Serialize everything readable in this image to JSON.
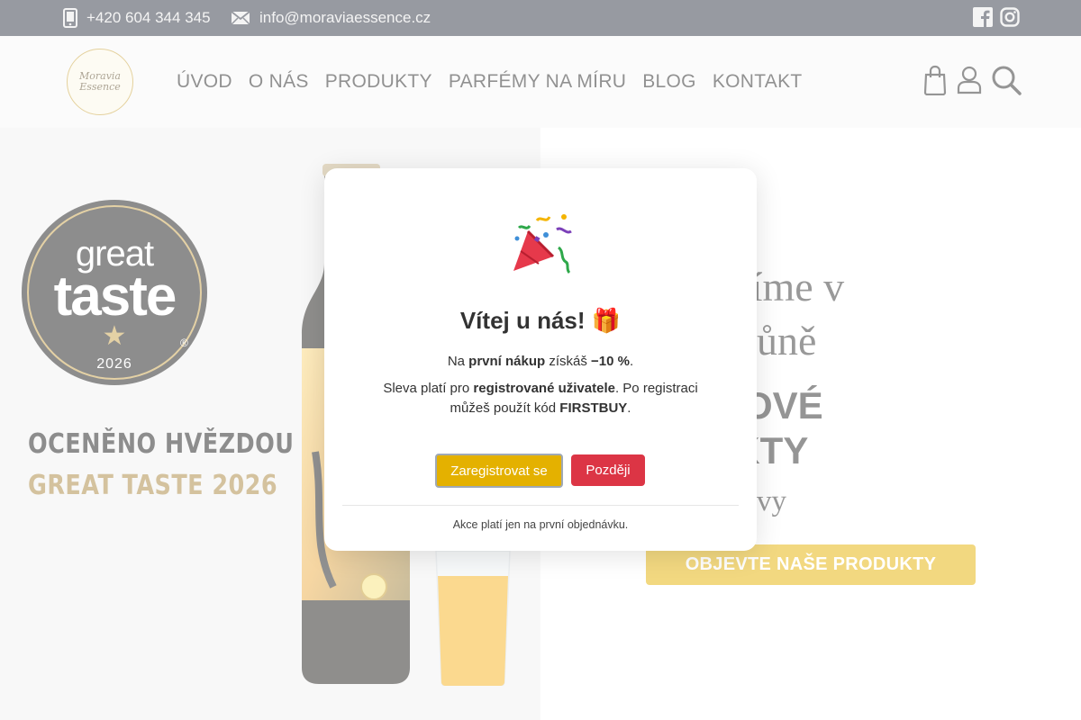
{
  "topbar": {
    "phone": "+420 604 344 345",
    "email": "info@moraviaessence.cz",
    "social": [
      "facebook-icon",
      "instagram-icon"
    ]
  },
  "header": {
    "logo_line1": "Moravia",
    "logo_line2": "Essence",
    "nav": [
      "ÚVOD",
      "O NÁS",
      "PRODUKTY",
      "PARFÉMY NA MÍRU",
      "BLOG",
      "KONTAKT"
    ],
    "icons": [
      "cart-icon",
      "user-icon",
      "search-icon"
    ]
  },
  "hero": {
    "badge_great": "great",
    "badge_taste": "taste",
    "badge_year": "2026",
    "badge_reg": "®",
    "award_line1": "OCENĚNO HVĚZDOU",
    "award_line2": "GREAT TASTE 2026",
    "line1": "u měníme v",
    "line2": "atě a vůně",
    "line3": "RÉMIOVÉ",
    "line4": "ODUKTY",
    "line5": "žní Moravy",
    "cta": "OBJEVTE NAŠE PRODUKTY"
  },
  "modal": {
    "title": "Vítej u nás! 🎁",
    "text1_a": "Na ",
    "text1_b": "první nákup",
    "text1_c": " získáš ",
    "text1_d": "−10 %",
    "text1_e": ".",
    "text2_a": "Sleva platí pro ",
    "text2_b": "registrované uživatele",
    "text2_c": ". Po registraci můžeš použít kód ",
    "text2_d": "FIRSTBUY",
    "text2_e": ".",
    "register_label": "Zaregistrovat se",
    "later_label": "Později",
    "footer": "Akce platí jen na první objednávku."
  },
  "colors": {
    "topbar_bg": "#2f3542",
    "accent_gold": "#e4b100",
    "danger_red": "#dc3545"
  }
}
